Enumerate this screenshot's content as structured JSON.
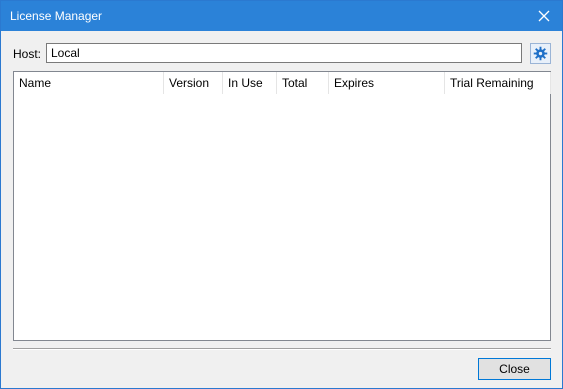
{
  "window": {
    "title": "License Manager",
    "close_icon": "close-icon"
  },
  "host": {
    "label": "Host:",
    "value": "Local",
    "settings_icon": "gear-icon"
  },
  "table": {
    "columns": [
      "Name",
      "Version",
      "In Use",
      "Total",
      "Expires",
      "Trial Remaining"
    ],
    "rows": []
  },
  "footer": {
    "close_label": "Close"
  },
  "colors": {
    "titlebar": "#2b82d8",
    "accent": "#0078d7"
  }
}
